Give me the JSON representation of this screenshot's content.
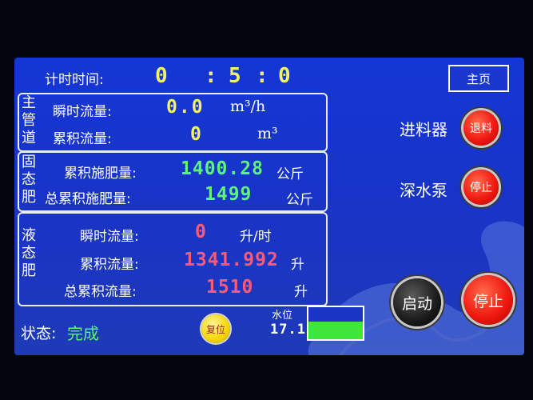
{
  "timer": {
    "label": "计时时间:",
    "h": "0",
    "m": "5",
    "s": "0",
    "sep": ":"
  },
  "home_label": "主页",
  "main_pipe": {
    "title": [
      "主",
      "管",
      "道"
    ],
    "instant_label": "瞬时流量:",
    "instant_value": "0.0",
    "instant_unit": "m³/h",
    "total_label": "累积流量:",
    "total_value": "0",
    "total_unit": "m³"
  },
  "solid": {
    "title": [
      "固",
      "态",
      "肥"
    ],
    "acc_label": "累积施肥量:",
    "acc_value": "1400.28",
    "acc_unit": "公斤",
    "total_label": "总累积施肥量:",
    "total_value": "1499",
    "total_unit": "公斤"
  },
  "liquid": {
    "title": [
      "液",
      "态",
      "肥"
    ],
    "instant_label": "瞬时流量:",
    "instant_value": "0",
    "instant_unit": "升/时",
    "acc_label": "累积流量:",
    "acc_value": "1341.992",
    "acc_unit": "升",
    "total_label": "总累积流量:",
    "total_value": "1510",
    "total_unit": "升"
  },
  "feeder": {
    "label": "进料器",
    "button": "退料"
  },
  "pump": {
    "label": "深水泵",
    "button": "停止"
  },
  "start_label": "启动",
  "stop_label": "停止",
  "status": {
    "label": "状态:",
    "value": "完成"
  },
  "reset_label": "复位",
  "water_level": {
    "label": "水位",
    "value": "17.1",
    "fill_fraction": 0.55
  },
  "colors": {
    "screen_bg": "#1436d4",
    "value_yellow": "#f3f36a",
    "value_green": "#5ef575",
    "value_red": "#ff5a78",
    "level_fill": "#3ee63a"
  }
}
